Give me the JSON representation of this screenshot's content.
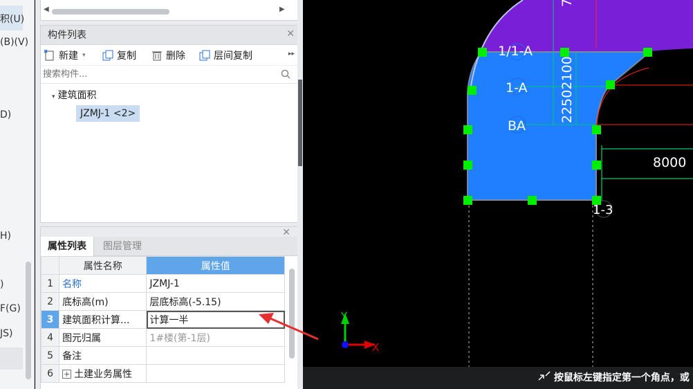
{
  "left_strip": {
    "items": [
      {
        "label": "积(U)"
      },
      {
        "label": "(B)(V)"
      },
      {
        "label": "D)"
      },
      {
        "label": "H)"
      },
      {
        "label": ")"
      },
      {
        "label": "F(G)"
      },
      {
        "label": "JS)"
      }
    ]
  },
  "component_panel": {
    "title": "构件列表",
    "toolbar": {
      "new_label": "新建",
      "copy_label": "复制",
      "delete_label": "删除",
      "floor_copy_label": "层间复制"
    },
    "search_placeholder": "搜索构件...",
    "tree": {
      "root_label": "建筑面积",
      "child_label": "JZMJ-1 <2>"
    }
  },
  "properties_panel": {
    "tab_properties": "属性列表",
    "tab_layers": "图层管理",
    "header_name": "属性名称",
    "header_value": "属性值",
    "rows": [
      {
        "num": "1",
        "name": "名称",
        "value": "JZMJ-1"
      },
      {
        "num": "2",
        "name": "底标高(m)",
        "value": "层底标高(-5.15)"
      },
      {
        "num": "3",
        "name": "建筑面积计算...",
        "value": "计算一半"
      },
      {
        "num": "4",
        "name": "图元归属",
        "value": "1#楼(第-1层)"
      },
      {
        "num": "5",
        "name": "备注",
        "value": ""
      },
      {
        "num": "6",
        "name": "土建业务属性",
        "value": ""
      }
    ]
  },
  "canvas": {
    "labels": {
      "axis_1_1A": "1/1-A",
      "axis_1A": "1-A",
      "axis_BA": "BA",
      "axis_13": "1-3",
      "dim_vertical": "22502100",
      "dim_top": "7",
      "dim_horizontal": "8000",
      "axis_y": "Y",
      "axis_x": "X"
    },
    "colors": {
      "blue_region": "#1f7fff",
      "purple_region": "#7a1fd8",
      "grip": "#00ee00",
      "dimension": "#00ff7f",
      "red_line": "#ff2020",
      "arrow": "#e43030"
    }
  },
  "status_bar": {
    "text": "按鼠标左键指定第一个角点，或"
  }
}
